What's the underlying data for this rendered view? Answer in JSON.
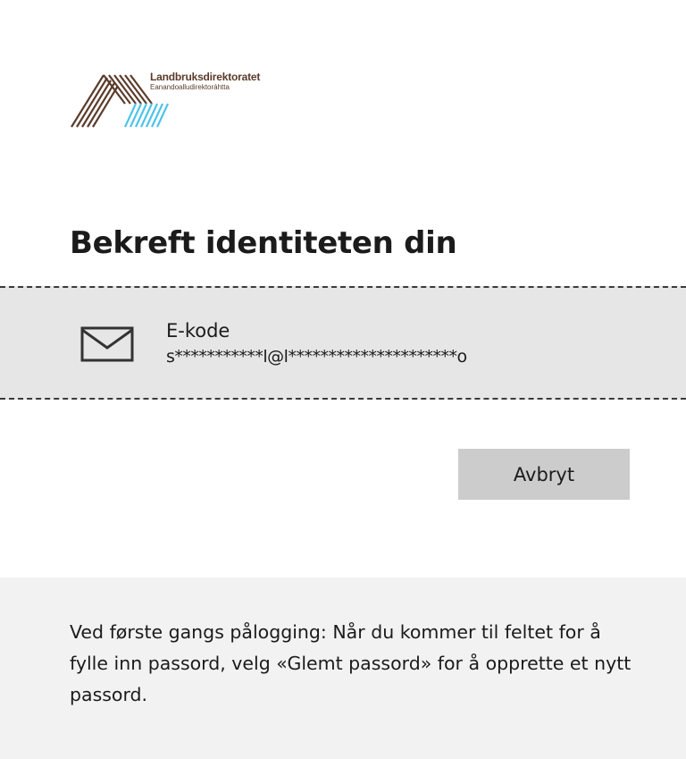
{
  "logo": {
    "name": "Landbruksdirektoratet",
    "sub": "Eanandoalludirektoráhtta"
  },
  "header": {
    "title": "Bekreft identiteten din"
  },
  "method": {
    "icon": "mail-icon",
    "label": "E-kode",
    "detail": "s***********l@l*********************o"
  },
  "actions": {
    "cancel_label": "Avbryt"
  },
  "footer": {
    "note": "Ved første gangs pålogging: Når du kommer til feltet for å fylle inn passord, velg «Glemt passord» for å opprette et nytt passord."
  },
  "colors": {
    "brand_brown": "#5a3b2a",
    "brand_blue": "#4fc3e8",
    "option_bg": "#e6e6e6",
    "button_bg": "#cccccc",
    "footer_bg": "#f2f2f2"
  }
}
